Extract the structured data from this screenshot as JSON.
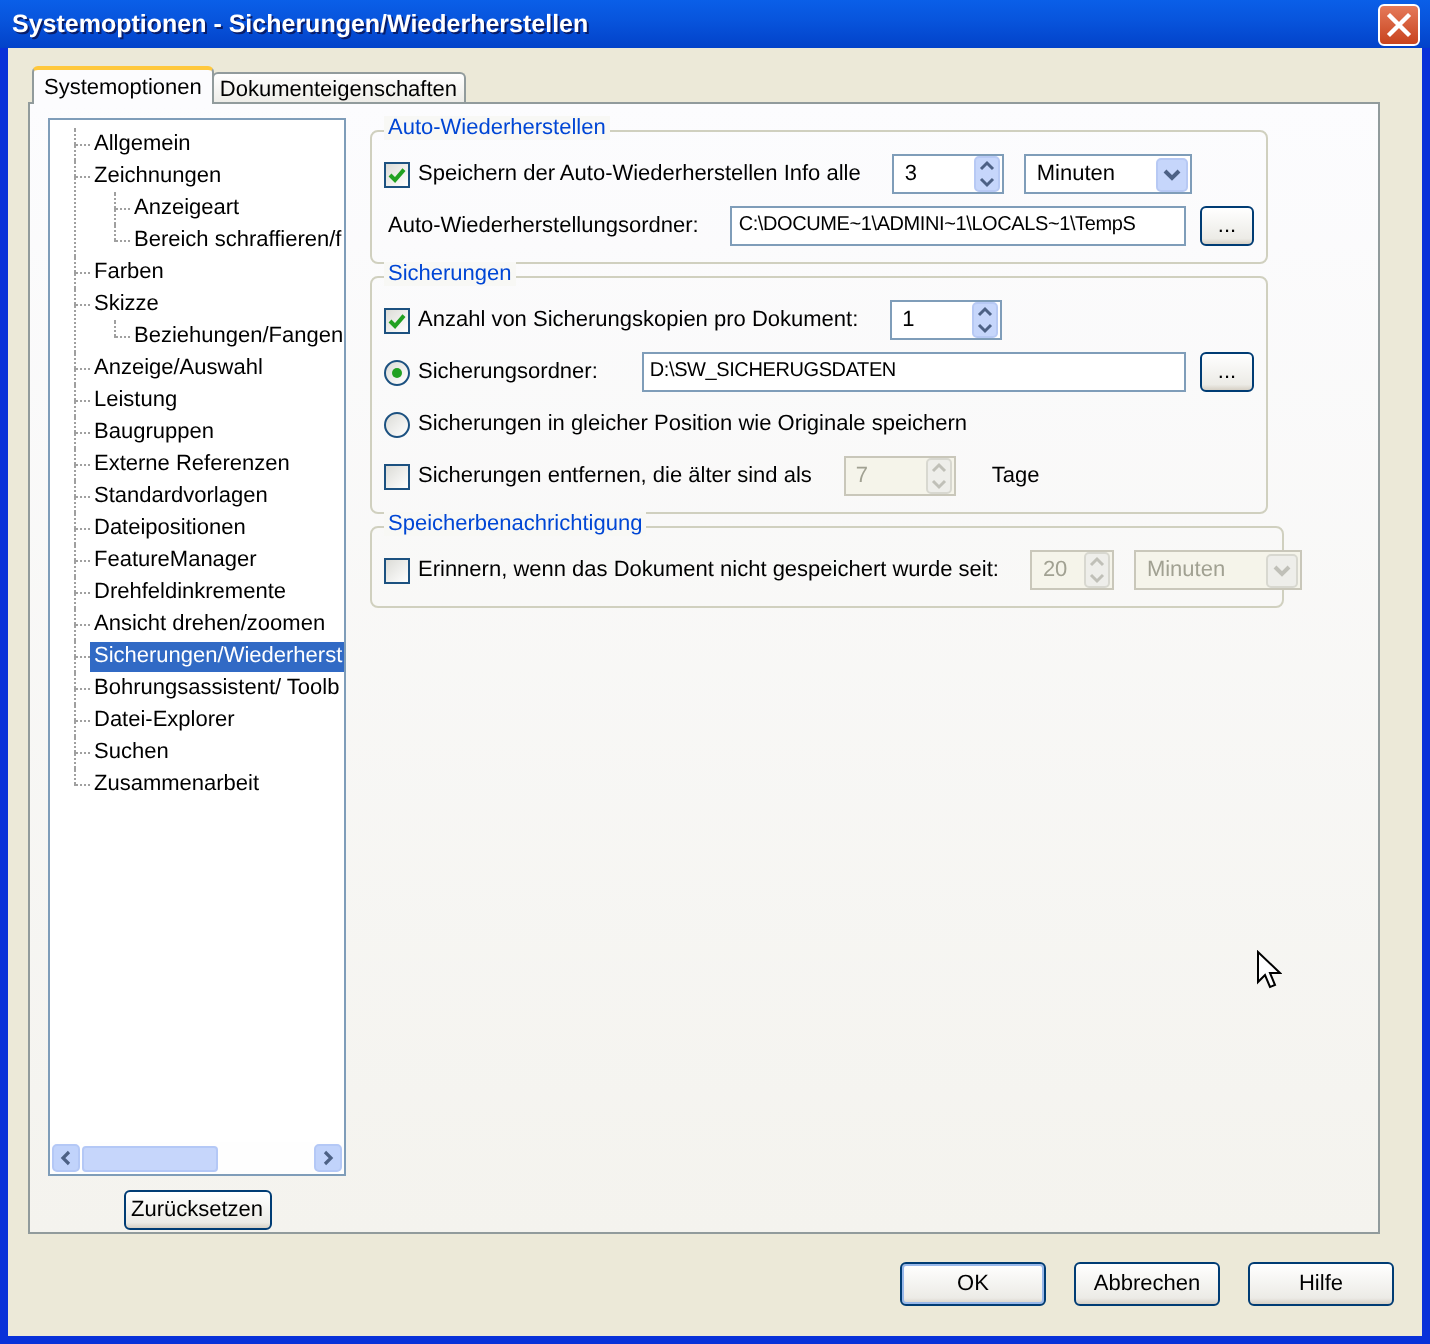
{
  "window": {
    "title": "Systemoptionen - Sicherungen/Wiederherstellen"
  },
  "tabs": [
    {
      "label": "Systemoptionen",
      "selected": true
    },
    {
      "label": "Dokumenteigenschaften",
      "selected": false
    }
  ],
  "tree": {
    "items": [
      {
        "label": "Allgemein",
        "selected": false
      },
      {
        "label": "Zeichnungen",
        "selected": false,
        "children": [
          {
            "label": "Anzeigeart",
            "selected": false
          },
          {
            "label": "Bereich schraffieren/f",
            "selected": false
          }
        ]
      },
      {
        "label": "Farben",
        "selected": false
      },
      {
        "label": "Skizze",
        "selected": false,
        "children": [
          {
            "label": "Beziehungen/Fangen",
            "selected": false
          }
        ]
      },
      {
        "label": "Anzeige/Auswahl",
        "selected": false
      },
      {
        "label": "Leistung",
        "selected": false
      },
      {
        "label": "Baugruppen",
        "selected": false
      },
      {
        "label": "Externe Referenzen",
        "selected": false
      },
      {
        "label": "Standardvorlagen",
        "selected": false
      },
      {
        "label": "Dateipositionen",
        "selected": false
      },
      {
        "label": "FeatureManager",
        "selected": false
      },
      {
        "label": "Drehfeldinkremente",
        "selected": false
      },
      {
        "label": "Ansicht drehen/zoomen",
        "selected": false
      },
      {
        "label": "Sicherungen/Wiederherst",
        "selected": true
      },
      {
        "label": "Bohrungsassistent/ Toolb",
        "selected": false
      },
      {
        "label": "Datei-Explorer",
        "selected": false
      },
      {
        "label": "Suchen",
        "selected": false
      },
      {
        "label": "Zusammenarbeit",
        "selected": false
      }
    ]
  },
  "reset_button": "Zurücksetzen",
  "groups": [
    {
      "title": "Auto-Wiederherstellen",
      "rows": [
        {
          "controls": [
            {
              "kind": "checkbox",
              "label": "Speichern der Auto-Wiederherstellen Info alle",
              "checked": true
            },
            {
              "kind": "spinner",
              "value": "3",
              "disabled": false
            },
            {
              "kind": "dropdown",
              "value": "Minuten",
              "disabled": false
            }
          ]
        },
        {
          "controls": [
            {
              "kind": "text",
              "label": "Auto-Wiederherstellungsordner:"
            },
            {
              "kind": "textfield",
              "value": "C:\\DOCUME~1\\ADMINI~1\\LOCALS~1\\TempS"
            },
            {
              "kind": "browse",
              "label": "..."
            }
          ]
        }
      ]
    },
    {
      "title": "Sicherungen",
      "rows": [
        {
          "controls": [
            {
              "kind": "checkbox",
              "label": "Anzahl von Sicherungskopien pro Dokument:",
              "checked": true
            },
            {
              "kind": "spinner",
              "value": "1",
              "disabled": false
            }
          ]
        },
        {
          "controls": [
            {
              "kind": "radio",
              "label": "Sicherungsordner:",
              "selected": true
            },
            {
              "kind": "textfield",
              "value": "D:\\SW_SICHERUGSDATEN"
            },
            {
              "kind": "browse",
              "label": "..."
            }
          ]
        },
        {
          "controls": [
            {
              "kind": "radio",
              "label": "Sicherungen in gleicher Position wie Originale speichern",
              "selected": false
            }
          ]
        },
        {
          "controls": [
            {
              "kind": "checkbox",
              "label": "Sicherungen entfernen, die älter sind als",
              "checked": false
            },
            {
              "kind": "spinner",
              "value": "7",
              "disabled": true
            },
            {
              "kind": "text",
              "label": "Tage"
            }
          ]
        }
      ]
    },
    {
      "title": "Speicherbenachrichtigung",
      "rows": [
        {
          "controls": [
            {
              "kind": "checkbox",
              "label": "Erinnern, wenn das Dokument nicht gespeichert wurde seit:",
              "checked": false
            },
            {
              "kind": "spinner",
              "value": "20",
              "disabled": true
            },
            {
              "kind": "dropdown",
              "value": "Minuten",
              "disabled": true
            }
          ]
        }
      ]
    }
  ],
  "buttons": [
    "OK",
    "Abbrechen",
    "Hilfe"
  ]
}
